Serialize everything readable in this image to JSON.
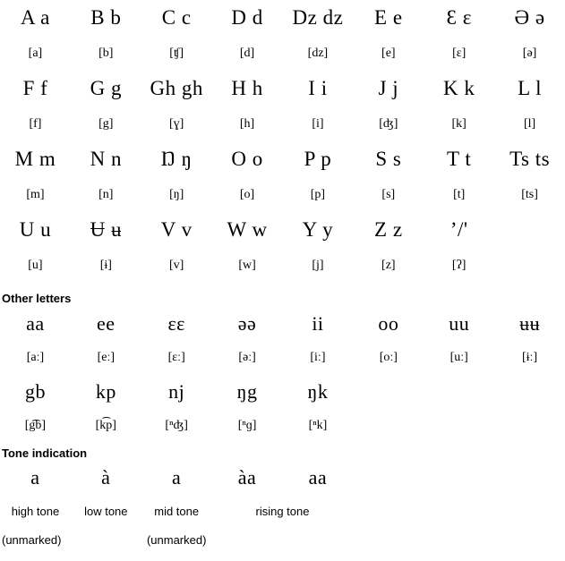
{
  "alphabet": {
    "rows": [
      {
        "letters": [
          "A a",
          "B b",
          "C c",
          "D d",
          "Dz dz",
          "E e",
          "Ɛ ɛ",
          "Ə ə"
        ],
        "ipa": [
          "[a]",
          "[b]",
          "[ʧ]",
          "[d]",
          "[dz]",
          "[e]",
          "[ɛ]",
          "[ə]"
        ]
      },
      {
        "letters": [
          "F f",
          "G g",
          "Gh gh",
          "H h",
          "I i",
          "J j",
          "K k",
          "L l"
        ],
        "ipa": [
          "[f]",
          "[g]",
          "[ɣ]",
          "[h]",
          "[i]",
          "[ʤ]",
          "[k]",
          "[l]"
        ]
      },
      {
        "letters": [
          "M m",
          "N n",
          "Ŋ ŋ",
          "O o",
          "P p",
          "S s",
          "T t",
          "Ts ts"
        ],
        "ipa": [
          "[m]",
          "[n]",
          "[ŋ]",
          "[o]",
          "[p]",
          "[s]",
          "[t]",
          "[ts]"
        ]
      },
      {
        "letters": [
          "U u",
          "Ʉ ʉ",
          "V v",
          "W w",
          "Y y",
          "Z z",
          "’/'",
          ""
        ],
        "ipa": [
          "[u]",
          "[ɨ]",
          "[v]",
          "[w]",
          "[j]",
          "[z]",
          "[ʔ]",
          ""
        ]
      }
    ]
  },
  "other_letters": {
    "heading": "Other letters",
    "rows": [
      {
        "letters": [
          "aa",
          "ee",
          "ɛɛ",
          "əə",
          "ii",
          "oo",
          "uu",
          "ʉʉ"
        ],
        "ipa": [
          "[aː]",
          "[eː]",
          "[ɛː]",
          "[əː]",
          "[iː]",
          "[oː]",
          "[uː]",
          "[ɨː]"
        ]
      },
      {
        "letters": [
          "gb",
          "kp",
          "nj",
          "ŋg",
          "ŋk",
          "",
          "",
          ""
        ],
        "ipa": [
          "[g͡b]",
          "[k͡p]",
          "[ⁿʤ]",
          "[ⁿɡ]",
          "[ⁿk]",
          "",
          "",
          ""
        ]
      }
    ]
  },
  "tone_indication": {
    "heading": "Tone indication",
    "letters": [
      "a",
      "à",
      "a",
      "àa",
      "aa",
      "",
      "",
      ""
    ],
    "labels": [
      "high tone",
      "low tone",
      "mid tone",
      "rising tone",
      "",
      "",
      "",
      ""
    ],
    "sub_labels": [
      "(unmarked)",
      "",
      "(unmarked)",
      "",
      "",
      "",
      "",
      ""
    ]
  }
}
